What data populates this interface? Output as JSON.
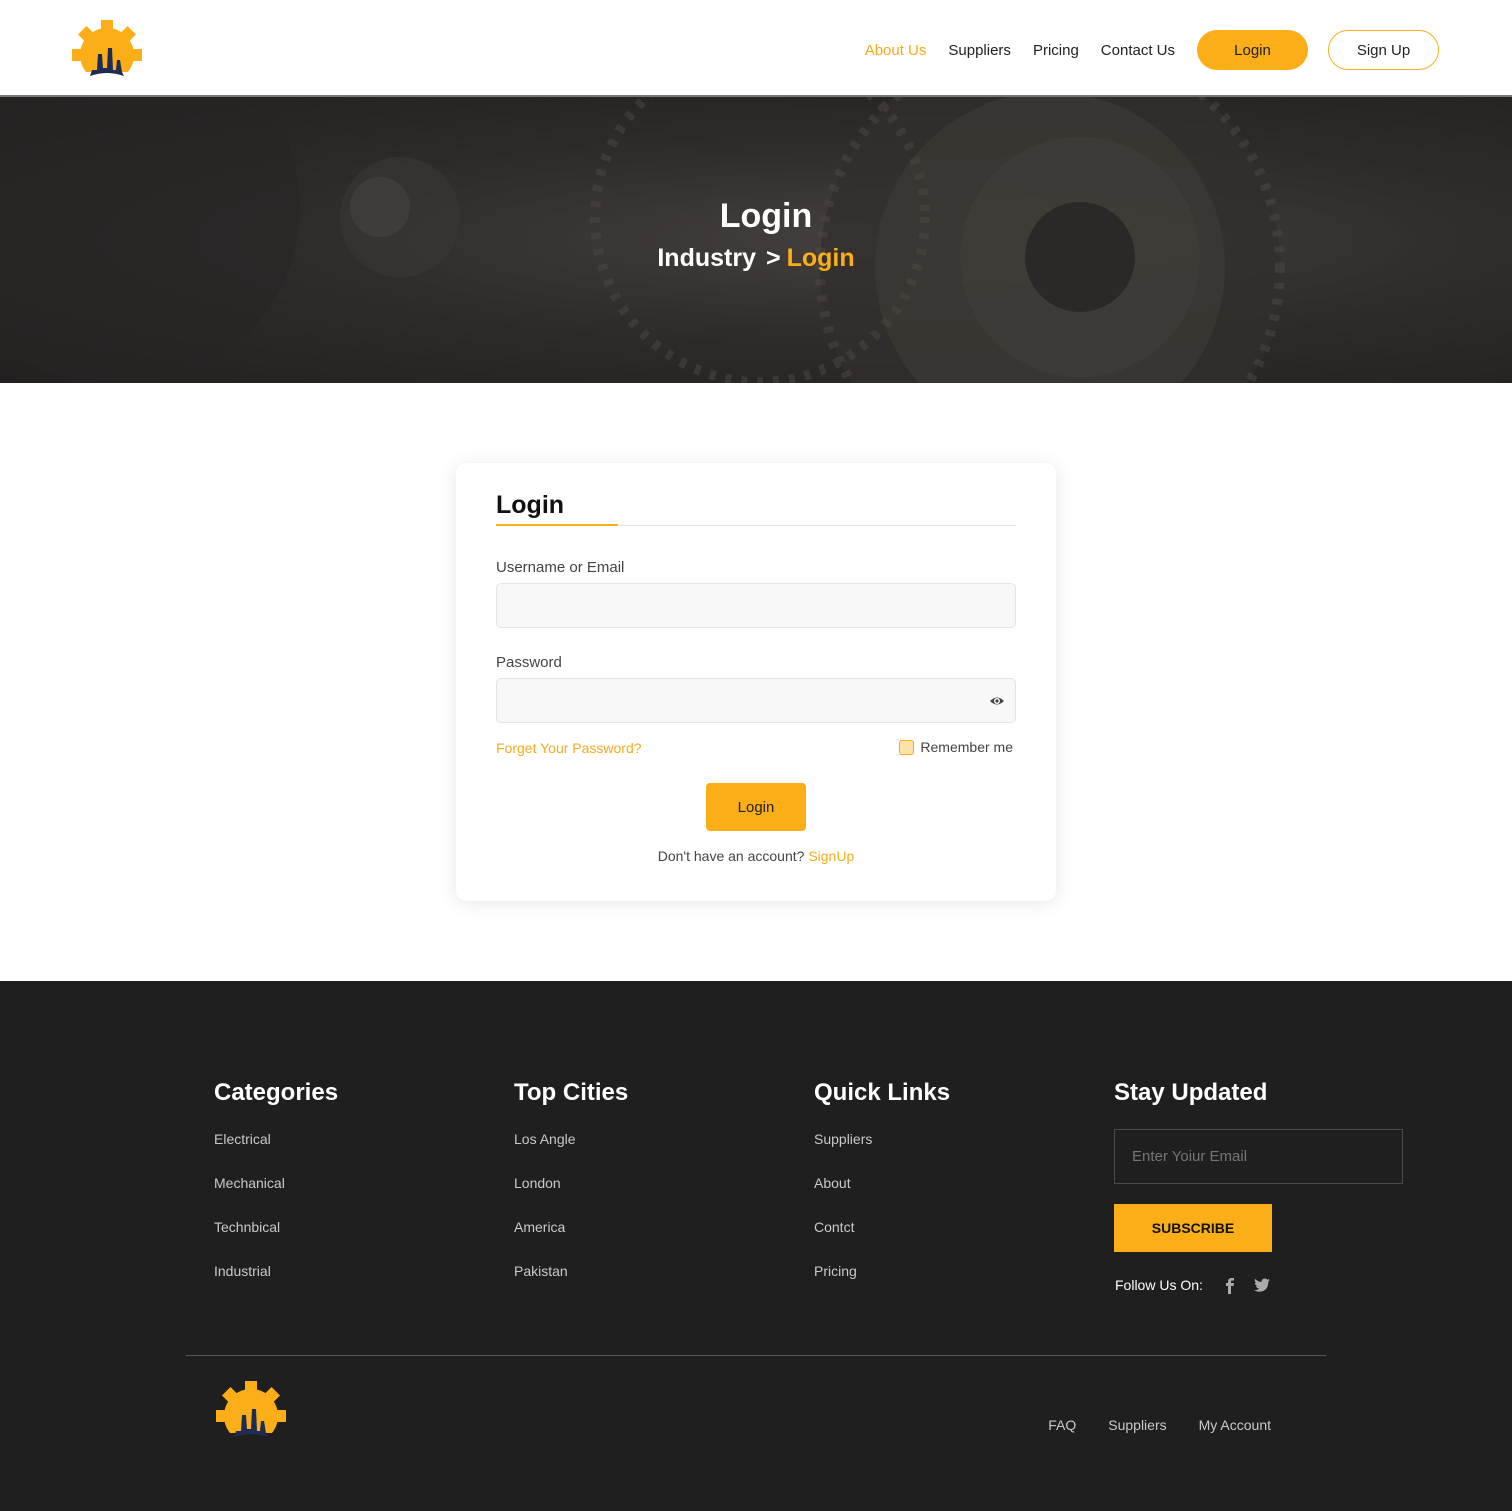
{
  "colors": {
    "accent": "#fbae17",
    "footer_bg": "#201f1f",
    "logo_blue": "#1e2c55"
  },
  "header": {
    "nav": [
      "About Us",
      "Suppliers",
      "Pricing",
      "Contact Us"
    ],
    "active_nav": "About Us",
    "login_label": "Login",
    "signup_label": "Sign Up"
  },
  "hero": {
    "title": "Login",
    "breadcrumb_root": "Industry",
    "breadcrumb_sep": ">",
    "breadcrumb_current": "Login"
  },
  "login_form": {
    "title": "Login",
    "username_label": "Username or Email",
    "username_value": "",
    "password_label": "Password",
    "password_value": "",
    "forgot_label": "Forget Your Password?",
    "remember_label": "Remember me",
    "submit_label": "Login",
    "no_account_text": "Don't have an account?",
    "signup_link": "SignUp"
  },
  "footer": {
    "categories": {
      "title": "Categories",
      "items": [
        "Electrical",
        "Mechanical",
        "Technbical",
        "Industrial"
      ]
    },
    "top_cities": {
      "title": "Top Cities",
      "items": [
        "Los Angle",
        "London",
        "America",
        "Pakistan"
      ]
    },
    "quick_links": {
      "title": "Quick Links",
      "items": [
        "Suppliers",
        "About",
        "Contct",
        "Pricing"
      ]
    },
    "stay_updated": {
      "title": "Stay Updated",
      "email_placeholder": "Enter Yoiur Email",
      "subscribe_label": "SUBSCRIBE",
      "follow_label": "Follow Us On:",
      "social_icons": [
        "facebook-icon",
        "twitter-icon"
      ]
    },
    "bottom_links": [
      "FAQ",
      "Suppliers",
      "My Account"
    ]
  }
}
